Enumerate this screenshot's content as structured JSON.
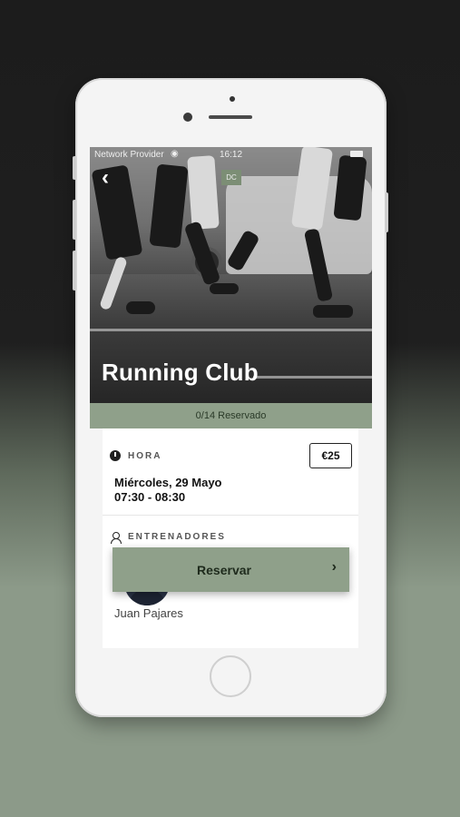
{
  "status_bar": {
    "provider": "Network Provider",
    "time": "16:12"
  },
  "hero": {
    "title": "Running Club",
    "logo_text": "DC"
  },
  "booking": {
    "reserved": "0/14 Reservado"
  },
  "schedule": {
    "section_label": "HORA",
    "price": "€25",
    "date": "Miércoles, 29 Mayo",
    "hours": "07:30 - 08:30"
  },
  "trainers": {
    "section_label": "ENTRENADORES",
    "items": [
      {
        "name": "Juan Pajares"
      }
    ]
  },
  "cta": {
    "label": "Reservar"
  },
  "icons": {
    "back": "back-chevron-icon",
    "wifi": "wifi-icon",
    "battery": "battery-icon",
    "clock": "clock-icon",
    "person": "person-icon",
    "chevron": "chevron-right-icon"
  },
  "colors": {
    "accent": "#8fa08a",
    "background_dark": "#1f1f1f"
  }
}
